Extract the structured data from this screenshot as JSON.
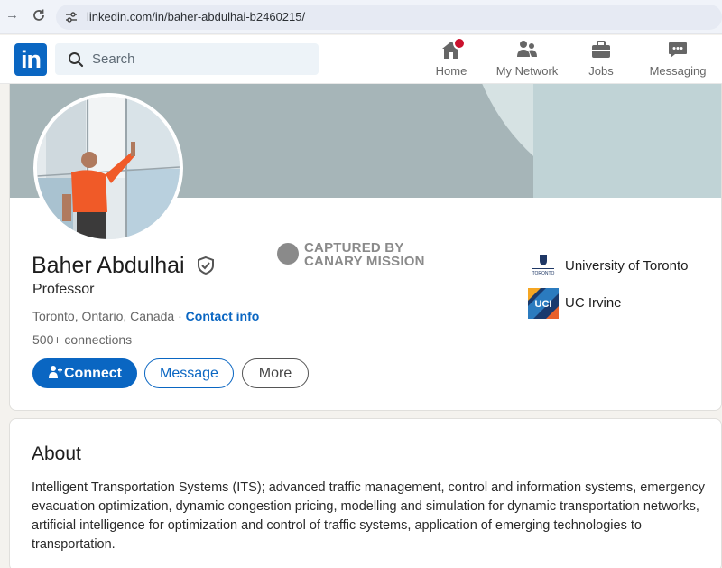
{
  "browser": {
    "url": "linkedin.com/in/baher-abdulhai-b2460215/"
  },
  "header": {
    "logo_text": "in",
    "search_placeholder": "Search",
    "nav": [
      {
        "label": "Home",
        "icon": "home-icon"
      },
      {
        "label": "My Network",
        "icon": "network-icon"
      },
      {
        "label": "Jobs",
        "icon": "briefcase-icon"
      },
      {
        "label": "Messaging",
        "icon": "messaging-icon"
      }
    ]
  },
  "profile": {
    "name": "Baher Abdulhai",
    "headline": "Professor",
    "location": "Toronto, Ontario, Canada",
    "contact_info": "Contact info",
    "connections": "500+ connections",
    "buttons": {
      "connect": "Connect",
      "message": "Message",
      "more": "More"
    },
    "watermark": {
      "line1": "CAPTURED BY",
      "line2": "CANARY MISSION"
    },
    "education": [
      {
        "name": "University of Toronto",
        "logo_text": "TORONTO"
      },
      {
        "name": "UC Irvine",
        "logo_text": "UCI"
      }
    ]
  },
  "about": {
    "title": "About",
    "text": "Intelligent Transportation Systems (ITS); advanced traffic management, control and information systems, emergency evacuation optimization, dynamic congestion pricing, modelling and simulation for dynamic transportation networks, artificial intelligence for optimization and control of traffic systems, application of emerging technologies to transportation."
  },
  "colors": {
    "brand": "#0a66c2",
    "badge": "#cb112d",
    "banner": "#a6b5b8"
  }
}
